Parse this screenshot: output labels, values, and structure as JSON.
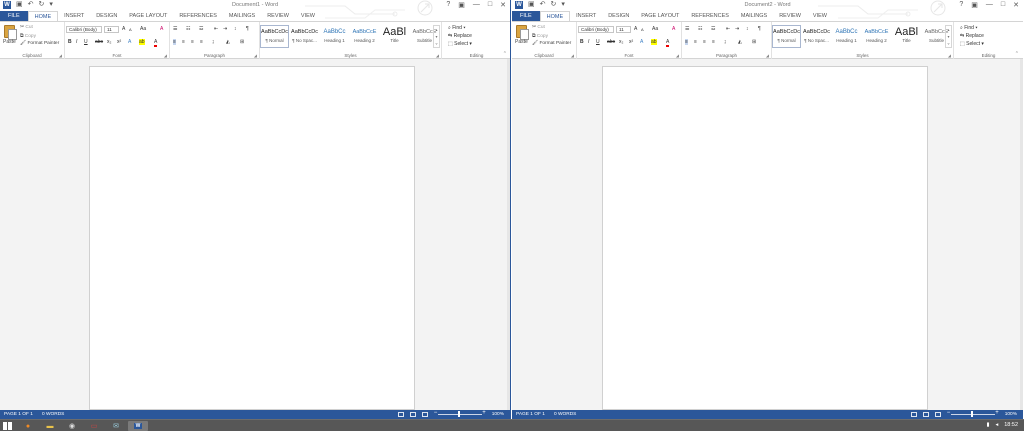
{
  "colors": {
    "accent": "#2b579a",
    "taskbar": "#575757"
  },
  "qat": {
    "word_icon": "word-icon",
    "save_icon": "save-icon",
    "undo_icon": "undo-icon",
    "redo_icon": "redo-icon"
  },
  "window_controls": {
    "help": "?",
    "ribbon_options": "▣",
    "minimize": "—",
    "maximize": "□",
    "close": "✕"
  },
  "tabs": [
    "FILE",
    "HOME",
    "INSERT",
    "DESIGN",
    "PAGE LAYOUT",
    "REFERENCES",
    "MAILINGS",
    "REVIEW",
    "VIEW"
  ],
  "clipboard": {
    "paste": "Paste",
    "cut": "Cut",
    "copy": "Copy",
    "format_painter": "Format Painter",
    "label": "Clipboard"
  },
  "font": {
    "name": "Calibri (Body)",
    "size": "11",
    "grow": "A",
    "shrink": "A",
    "case": "Aa",
    "clear": "A",
    "bold": "B",
    "italic": "I",
    "underline": "U",
    "strike": "abc",
    "subscript": "x₂",
    "superscript": "x²",
    "effects": "A",
    "highlight": "ab",
    "color": "A",
    "label": "Font"
  },
  "paragraph": {
    "label": "Paragraph",
    "pilcrow": "¶"
  },
  "styles": {
    "items": [
      {
        "preview": "AaBbCcDc",
        "name": "¶ Normal"
      },
      {
        "preview": "AaBbCcDc",
        "name": "¶ No Spac..."
      },
      {
        "preview": "AaBbCc",
        "name": "Heading 1"
      },
      {
        "preview": "AaBbCcE",
        "name": "Heading 2"
      },
      {
        "preview": "AaBl",
        "name": "Title"
      },
      {
        "preview": "AaBbCcE",
        "name": "Subtitle"
      }
    ],
    "label": "Styles"
  },
  "editing": {
    "find": "Find",
    "replace": "Replace",
    "select": "Select",
    "label": "Editing"
  },
  "windows": [
    {
      "title": "Document1 - Word",
      "status": {
        "page": "PAGE 1 OF 1",
        "words": "0 WORDS",
        "zoom": "100%"
      }
    },
    {
      "title": "Document2 - Word",
      "status": {
        "page": "PAGE 1 OF 1",
        "words": "0 WORDS",
        "zoom": "100%"
      }
    }
  ],
  "taskbar": {
    "apps": [
      "firefox-icon",
      "file-explorer-icon",
      "steam-icon",
      "media-icon",
      "mail-icon",
      "word-icon"
    ],
    "clock": "18:52"
  }
}
